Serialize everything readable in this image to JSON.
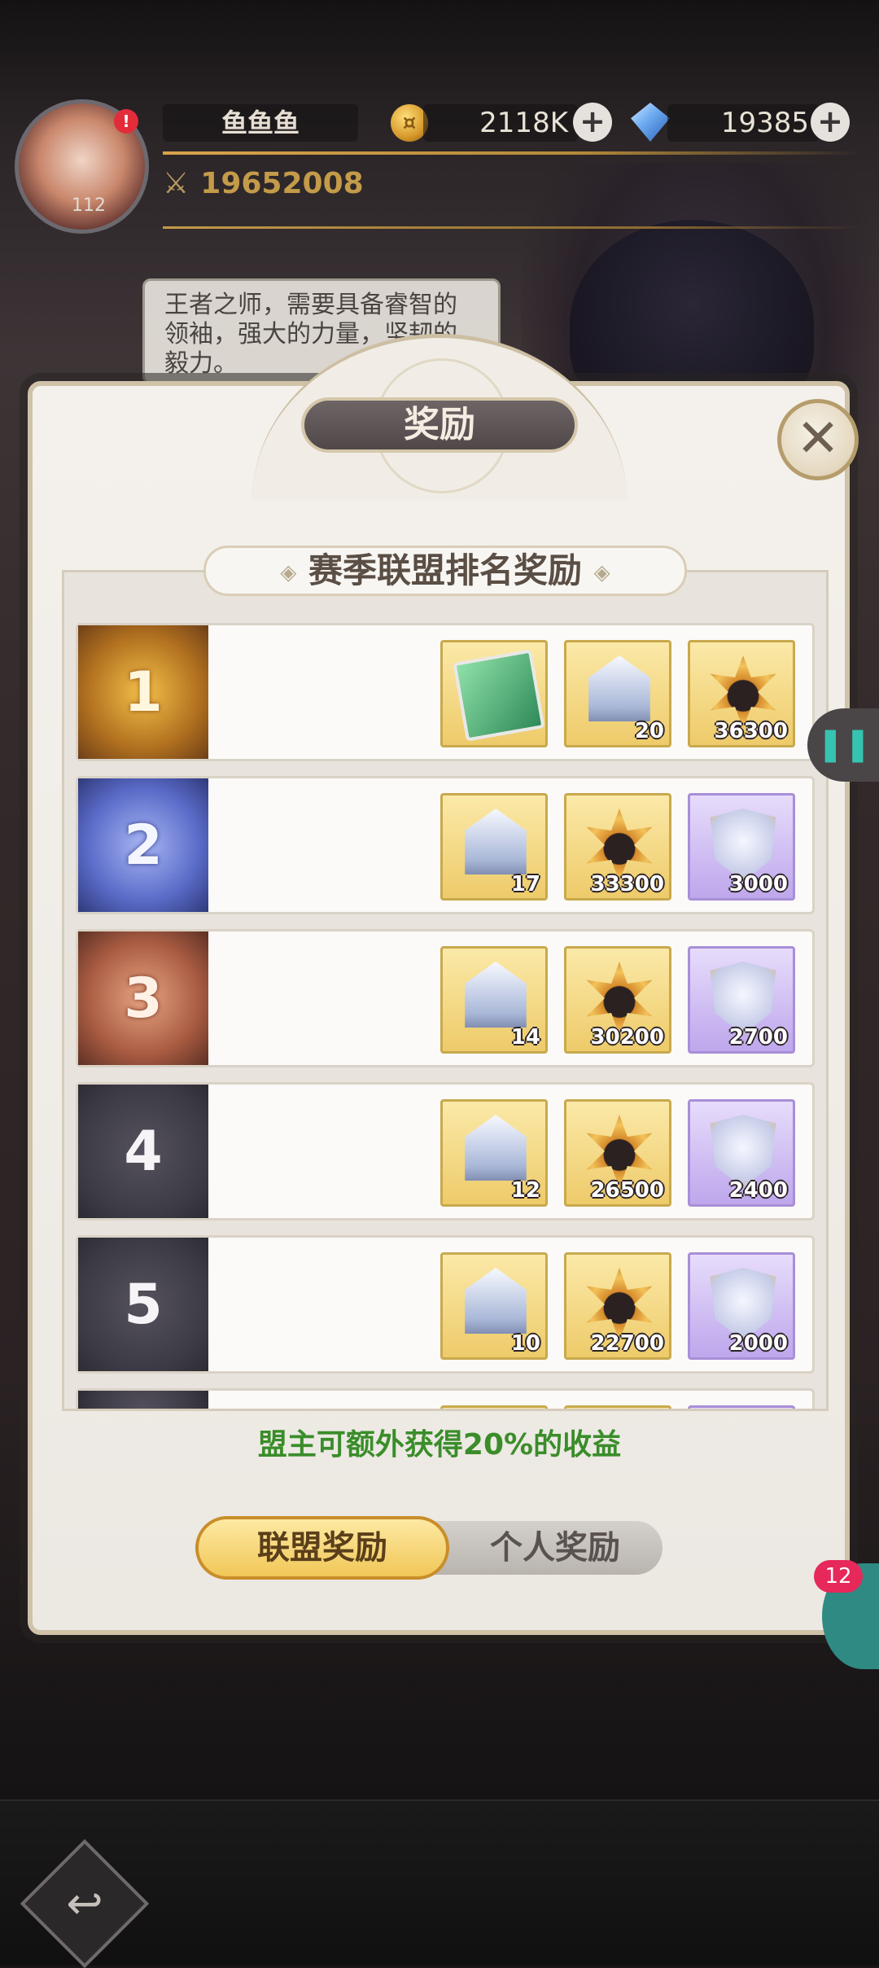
{
  "player": {
    "name": "鱼鱼鱼",
    "level": "112",
    "alert": "!",
    "coins": "2118K",
    "gems": "19385",
    "power": "19652008"
  },
  "quote": "王者之师，需要具备睿智的领袖，强大的力量，坚韧的毅力。",
  "modal": {
    "title": "奖励",
    "section_title": "赛季联盟排名奖励",
    "bonus_note": "盟主可额外获得20%的收益",
    "tabs": {
      "alliance": "联盟奖励",
      "personal": "个人奖励"
    },
    "close_label": "✕"
  },
  "ranks": [
    {
      "rank": "1",
      "rewards": [
        {
          "icon": "book-icon",
          "qty": ""
        },
        {
          "icon": "chest-icon",
          "qty": "20"
        },
        {
          "icon": "medal-icon",
          "qty": "36300"
        }
      ]
    },
    {
      "rank": "2",
      "rewards": [
        {
          "icon": "chest-icon",
          "qty": "17"
        },
        {
          "icon": "medal-icon",
          "qty": "33300"
        },
        {
          "icon": "shield-icon",
          "qty": "3000"
        }
      ]
    },
    {
      "rank": "3",
      "rewards": [
        {
          "icon": "chest-icon",
          "qty": "14"
        },
        {
          "icon": "medal-icon",
          "qty": "30200"
        },
        {
          "icon": "shield-icon",
          "qty": "2700"
        }
      ]
    },
    {
      "rank": "4",
      "rewards": [
        {
          "icon": "chest-icon",
          "qty": "12"
        },
        {
          "icon": "medal-icon",
          "qty": "26500"
        },
        {
          "icon": "shield-icon",
          "qty": "2400"
        }
      ]
    },
    {
      "rank": "5",
      "rewards": [
        {
          "icon": "chest-icon",
          "qty": "10"
        },
        {
          "icon": "medal-icon",
          "qty": "22700"
        },
        {
          "icon": "shield-icon",
          "qty": "2000"
        }
      ]
    }
  ],
  "side": {
    "notification_count": "12",
    "handle_icon": "pause-icon"
  },
  "colors": {
    "bonus_text": "#3a8d2a",
    "active_tab": "#f1c757",
    "accent_gold": "#c98e2a"
  }
}
